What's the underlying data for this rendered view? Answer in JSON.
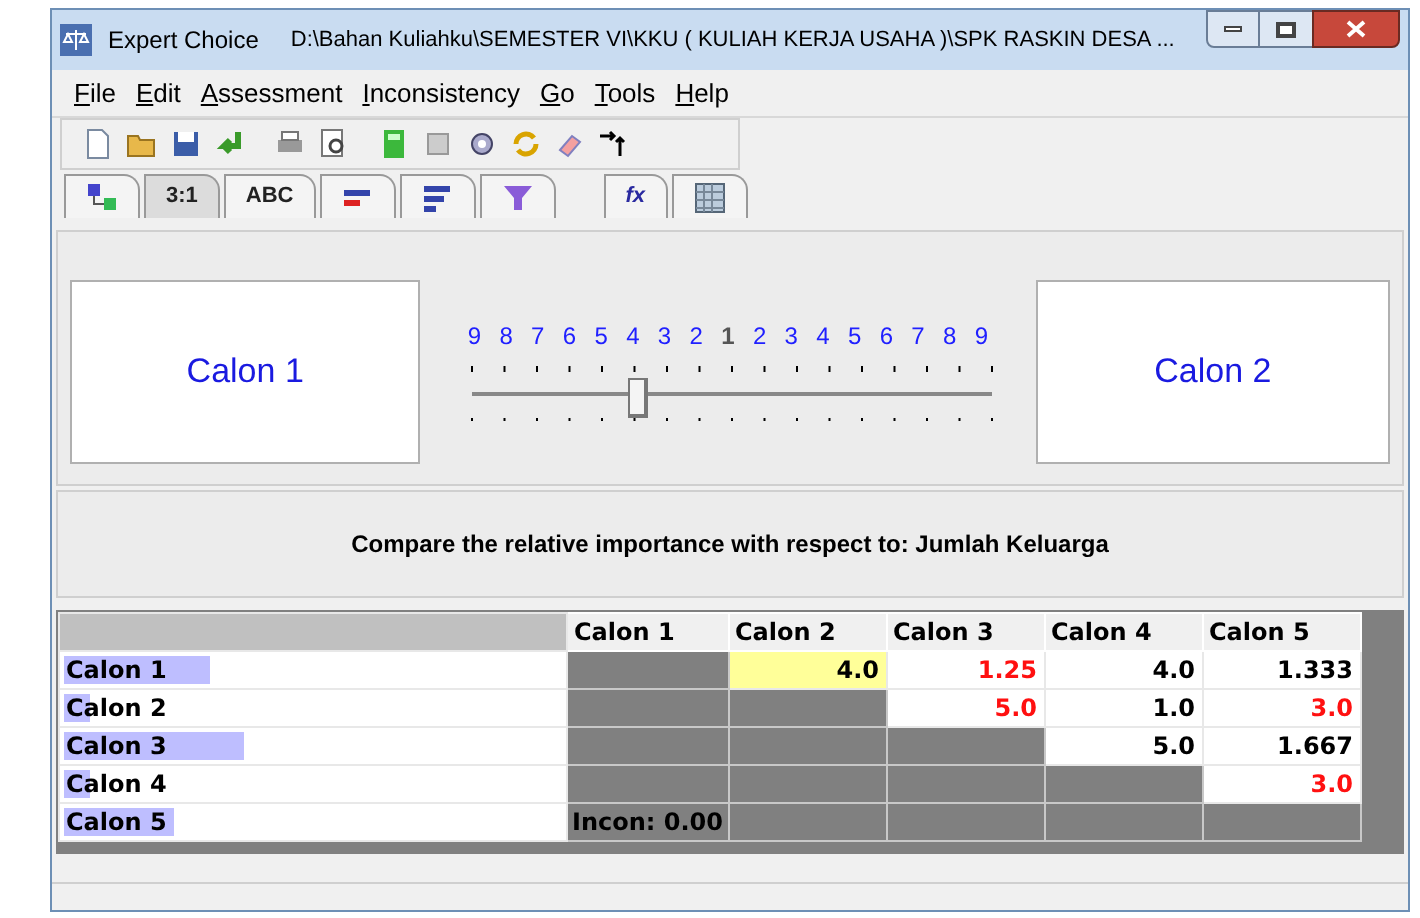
{
  "window": {
    "title": "Expert Choice",
    "path": "D:\\Bahan Kuliahku\\SEMESTER VI\\KKU ( KULIAH KERJA USAHA )\\SPK RASKIN DESA  ..."
  },
  "menu": [
    {
      "label": "File"
    },
    {
      "label": "Edit"
    },
    {
      "label": "Assessment"
    },
    {
      "label": "Inconsistency"
    },
    {
      "label": "Go"
    },
    {
      "label": "Tools"
    },
    {
      "label": "Help"
    }
  ],
  "tabs": [
    {
      "kind": "tree",
      "selected": false
    },
    {
      "kind": "text",
      "label": "3:1",
      "selected": true
    },
    {
      "kind": "text",
      "label": "ABC",
      "selected": false
    },
    {
      "kind": "bars",
      "selected": false
    },
    {
      "kind": "sorted",
      "selected": false
    },
    {
      "kind": "funnel",
      "selected": false
    },
    {
      "kind": "text",
      "label": "fx",
      "selected": false
    },
    {
      "kind": "grid",
      "selected": false
    }
  ],
  "comparison": {
    "left": "Calon 1",
    "right": "Calon 2",
    "scale": [
      "9",
      "8",
      "7",
      "6",
      "5",
      "4",
      "3",
      "2",
      "1",
      "2",
      "3",
      "4",
      "5",
      "6",
      "7",
      "8",
      "9"
    ],
    "slider": {
      "level": 0.32
    }
  },
  "prompt": "Compare the relative importance with respect to: Jumlah Keluarga",
  "matrix": {
    "columns": [
      "Calon 1",
      "Calon 2",
      "Calon 3",
      "Calon 4",
      "Calon 5"
    ],
    "rows": [
      {
        "label": "Calon 1",
        "level": 0.29,
        "cells": [
          {
            "kind": "blocked"
          },
          {
            "kind": "value",
            "text": "4.0",
            "inverse": false,
            "selected": true
          },
          {
            "kind": "value",
            "text": "1.25",
            "inverse": true,
            "selected": false
          },
          {
            "kind": "value",
            "text": "4.0",
            "inverse": false,
            "selected": false
          },
          {
            "kind": "value",
            "text": "1.333",
            "inverse": false,
            "selected": false
          }
        ]
      },
      {
        "label": "Calon 2",
        "level": 0.05,
        "cells": [
          {
            "kind": "blocked"
          },
          {
            "kind": "blocked"
          },
          {
            "kind": "value",
            "text": "5.0",
            "inverse": true,
            "selected": false
          },
          {
            "kind": "value",
            "text": "1.0",
            "inverse": false,
            "selected": false
          },
          {
            "kind": "value",
            "text": "3.0",
            "inverse": true,
            "selected": false
          }
        ]
      },
      {
        "label": "Calon 3",
        "level": 0.36,
        "cells": [
          {
            "kind": "blocked"
          },
          {
            "kind": "blocked"
          },
          {
            "kind": "blocked"
          },
          {
            "kind": "value",
            "text": "5.0",
            "inverse": false,
            "selected": false
          },
          {
            "kind": "value",
            "text": "1.667",
            "inverse": false,
            "selected": false
          }
        ]
      },
      {
        "label": "Calon 4",
        "level": 0.05,
        "cells": [
          {
            "kind": "blocked"
          },
          {
            "kind": "blocked"
          },
          {
            "kind": "blocked"
          },
          {
            "kind": "blocked"
          },
          {
            "kind": "value",
            "text": "3.0",
            "inverse": true,
            "selected": false
          }
        ]
      },
      {
        "label": "Calon 5",
        "level": 0.22,
        "cells": [
          {
            "kind": "incon",
            "text": "Incon: 0.00"
          },
          {
            "kind": "blocked"
          },
          {
            "kind": "blocked"
          },
          {
            "kind": "blocked"
          },
          {
            "kind": "blocked"
          }
        ]
      }
    ]
  }
}
